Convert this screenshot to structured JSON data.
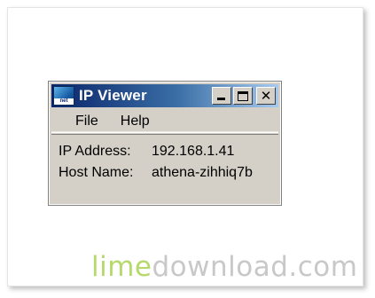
{
  "window": {
    "title": "IP Viewer",
    "icon_name": "network-computer-icon",
    "icon_label": "net",
    "buttons": {
      "minimize_icon": "minimize-icon",
      "maximize_icon": "maximize-icon",
      "close_icon": "close-icon",
      "close_glyph": "✕"
    }
  },
  "menu": {
    "items": [
      {
        "label": "File"
      },
      {
        "label": "Help"
      }
    ]
  },
  "info": {
    "ip_label": "IP Address:",
    "ip_value": "192.168.1.41",
    "host_label": "Host Name:",
    "host_value": "athena-zihhiq7b"
  },
  "watermark": {
    "part1": "lime",
    "part2": "download.com"
  },
  "colors": {
    "title_gradient_start": "#0a246a",
    "title_gradient_end": "#a6caf0",
    "window_face": "#d4d0c8",
    "watermark_lime": "#b5d96b",
    "watermark_grey": "#c8c8c8"
  }
}
